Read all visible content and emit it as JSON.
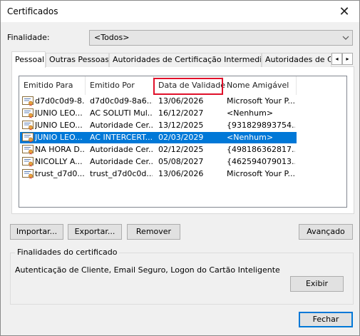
{
  "window": {
    "title": "Certificados",
    "close_glyph": "✕"
  },
  "finalidade": {
    "label": "Finalidade:",
    "selected": "<Todos>"
  },
  "tabs": [
    {
      "label": "Pessoal",
      "active": true
    },
    {
      "label": "Outras Pessoas"
    },
    {
      "label": "Autoridades de Certificação Intermediárias"
    },
    {
      "label": "Autoridades de Ce"
    }
  ],
  "tab_scroll": {
    "left": "◂",
    "right": "▸"
  },
  "columns": [
    "Emitido Para",
    "Emitido Por",
    "Data de Validade",
    "Nome Amigável"
  ],
  "rows": [
    {
      "issued_to": "d7d0c0d9-8...",
      "issued_by": "d7d0c0d9-8a6...",
      "expiry": "13/06/2026",
      "friendly": "Microsoft Your P...",
      "selected": false
    },
    {
      "issued_to": "JUNIO LEO...",
      "issued_by": "AC SOLUTI Mul...",
      "expiry": "16/12/2027",
      "friendly": "<Nenhum>",
      "selected": false
    },
    {
      "issued_to": "JUNIO LEO...",
      "issued_by": "Autoridade Cer...",
      "expiry": "13/12/2025",
      "friendly": "{931829893754...",
      "selected": false
    },
    {
      "issued_to": "JUNIO LEO...",
      "issued_by": "AC INTERCERT...",
      "expiry": "02/03/2029",
      "friendly": "<Nenhum>",
      "selected": true
    },
    {
      "issued_to": "NA HORA D...",
      "issued_by": "Autoridade Cer...",
      "expiry": "02/12/2025",
      "friendly": "{498186362817...",
      "selected": false
    },
    {
      "issued_to": "NICOLLY A...",
      "issued_by": "Autoridade Cer...",
      "expiry": "05/08/2027",
      "friendly": "{462594079013...",
      "selected": false
    },
    {
      "issued_to": "trust_d7d0...",
      "issued_by": "trust_d7d0c0d...",
      "expiry": "13/06/2026",
      "friendly": "Microsoft Your P...",
      "selected": false
    }
  ],
  "buttons": {
    "importar": "Importar...",
    "exportar": "Exportar...",
    "remover": "Remover",
    "avancado": "Avançado",
    "exibir": "Exibir",
    "fechar": "Fechar"
  },
  "purposes": {
    "title": "Finalidades do certificado",
    "text": "Autenticação de Cliente, Email Seguro, Logon do Cartão Inteligente"
  },
  "colors": {
    "selection": "#0078d7",
    "highlight_box": "#e0102a"
  }
}
